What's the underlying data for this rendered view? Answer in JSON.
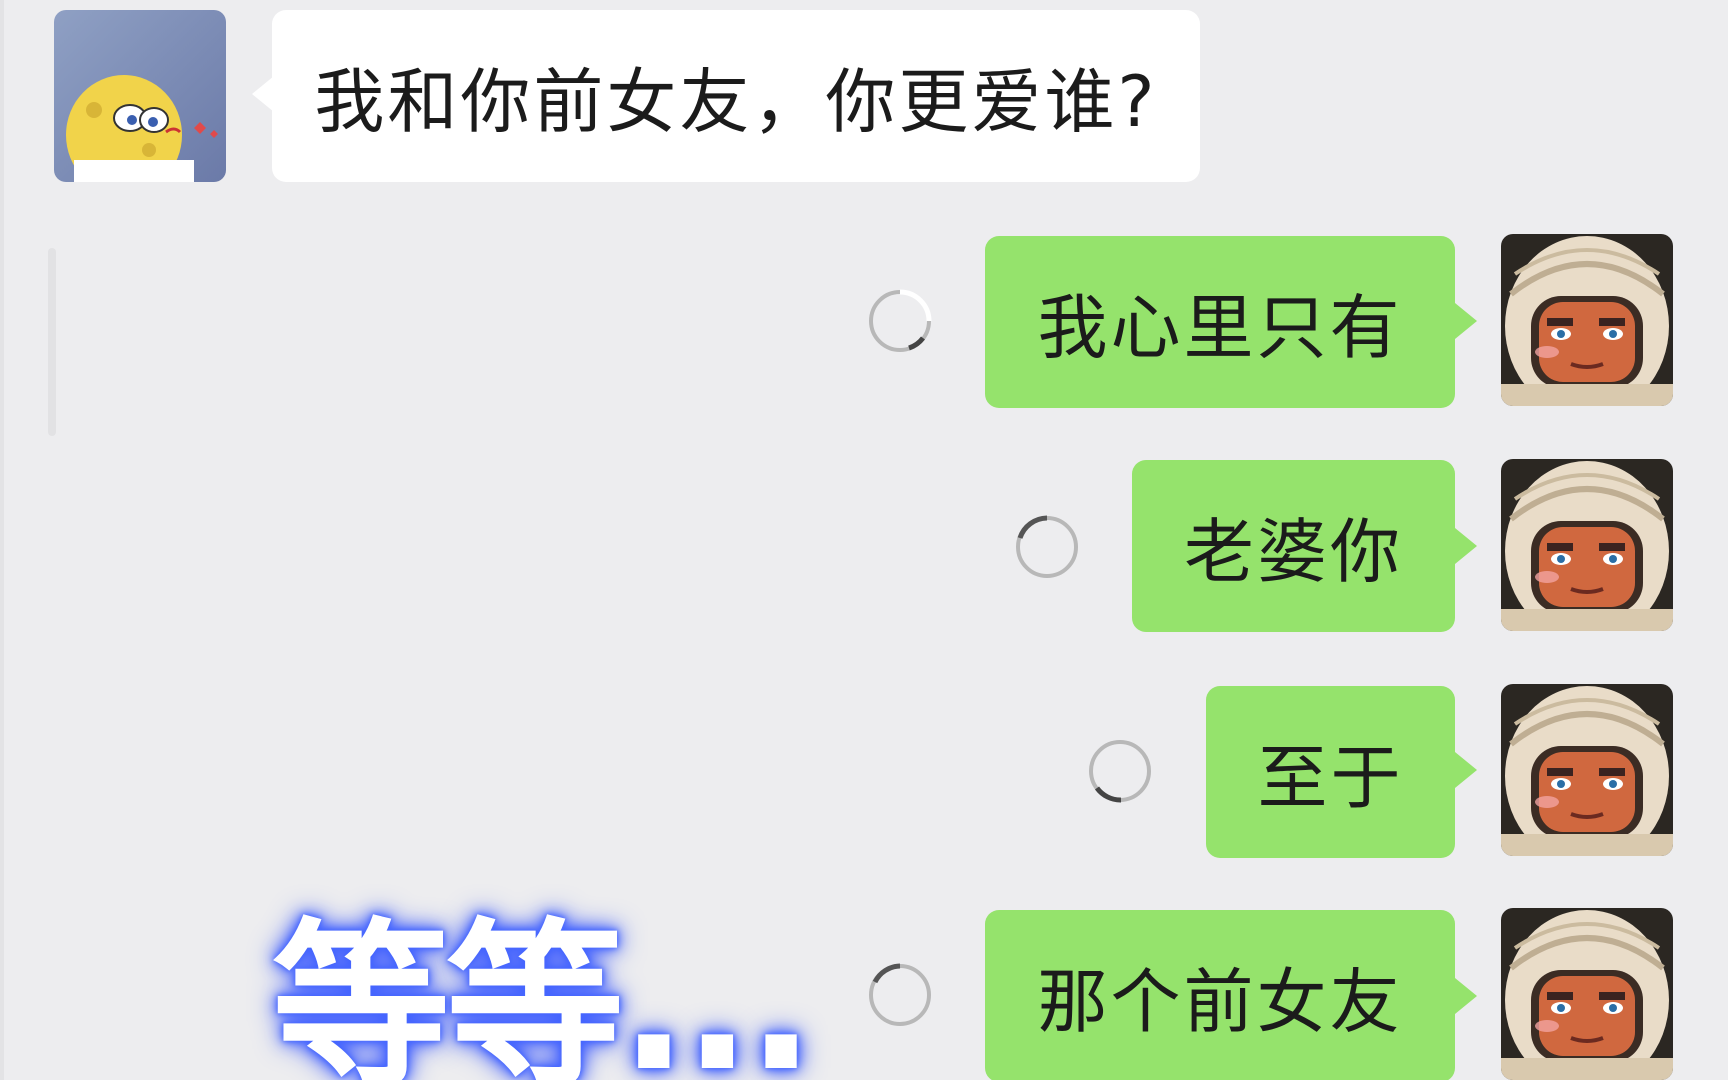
{
  "conversation": {
    "incoming": {
      "avatar_icon": "spongebob-avatar-icon",
      "text": "我和你前女友，你更爱谁?"
    },
    "outgoing": [
      {
        "text": "我心里只有",
        "status_icon": "loading-spinner-icon"
      },
      {
        "text": "老婆你",
        "status_icon": "loading-spinner-icon"
      },
      {
        "text": "至于",
        "status_icon": "loading-spinner-icon"
      },
      {
        "text": "那个前女友",
        "status_icon": "loading-spinner-icon"
      }
    ],
    "outgoing_avatar_icon": "astronaut-avatar-icon"
  },
  "overlay": {
    "caption": "等等..."
  },
  "colors": {
    "background": "#ededef",
    "incoming_bubble": "#ffffff",
    "outgoing_bubble": "#95e36c",
    "caption_glow": "#3b5cff"
  }
}
